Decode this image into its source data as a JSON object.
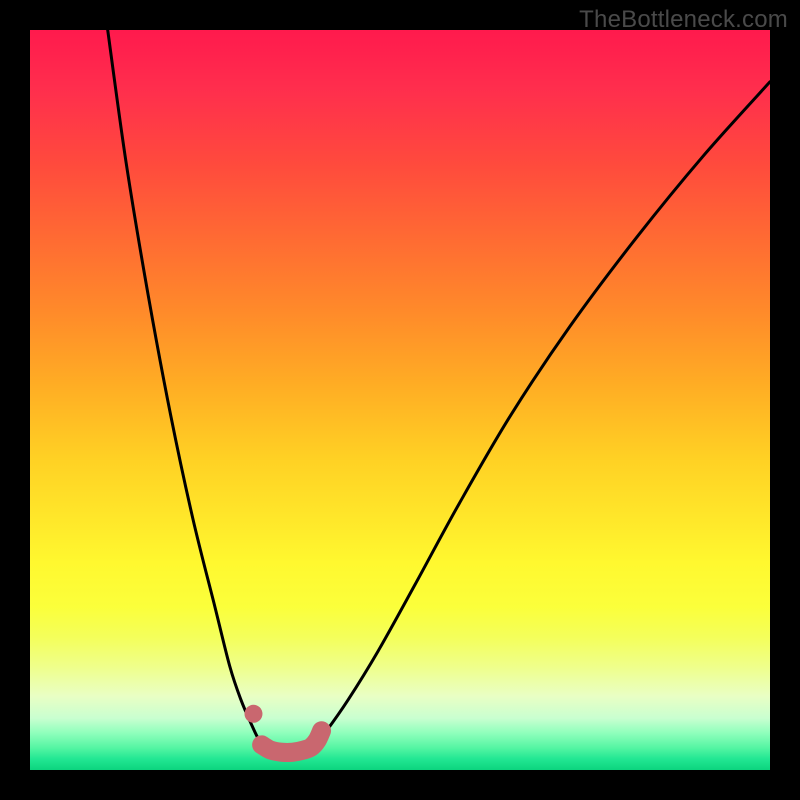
{
  "watermark": {
    "text": "TheBottleneck.com"
  },
  "colors": {
    "curve_stroke": "#000000",
    "marker_fill": "#c9676f",
    "marker_stroke": "#c9676f"
  },
  "chart_data": {
    "type": "line",
    "title": "",
    "xlabel": "",
    "ylabel": "",
    "xlim": [
      0,
      100
    ],
    "ylim": [
      0,
      100
    ],
    "series": [
      {
        "name": "curve-left",
        "x": [
          10.5,
          13,
          16,
          19,
          22,
          25,
          27,
          28.5,
          30,
          31,
          32
        ],
        "y": [
          100,
          82,
          64,
          48,
          34,
          22,
          14,
          9.5,
          6,
          4,
          3.2
        ]
      },
      {
        "name": "curve-right",
        "x": [
          38.5,
          40,
          43,
          47,
          52,
          58,
          65,
          73,
          82,
          91,
          100
        ],
        "y": [
          3.4,
          5.2,
          9.5,
          16,
          25,
          36,
          48,
          60,
          72,
          83,
          93
        ]
      },
      {
        "name": "flat-bottom",
        "x": [
          31,
          32,
          33.5,
          35,
          36.5,
          38,
          39.5
        ],
        "y": [
          3.0,
          2.6,
          2.3,
          2.2,
          2.3,
          2.8,
          3.4
        ]
      }
    ],
    "markers": [
      {
        "x": 30.2,
        "y": 7.6
      },
      {
        "x": 31.3,
        "y": 3.4
      },
      {
        "x": 32.5,
        "y": 2.7
      },
      {
        "x": 34.0,
        "y": 2.4
      },
      {
        "x": 35.5,
        "y": 2.4
      },
      {
        "x": 37.0,
        "y": 2.7
      },
      {
        "x": 38.0,
        "y": 3.1
      },
      {
        "x": 38.8,
        "y": 4.0
      },
      {
        "x": 39.4,
        "y": 5.3
      }
    ]
  }
}
